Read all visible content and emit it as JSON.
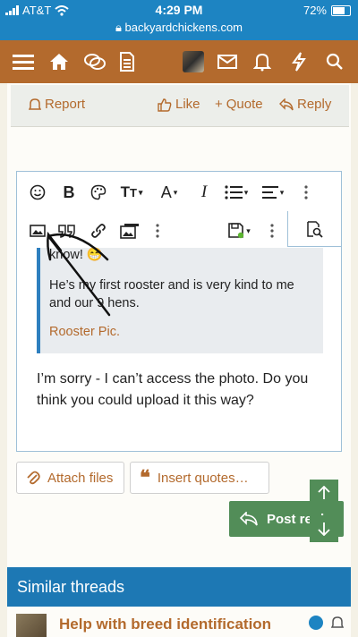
{
  "status_bar": {
    "carrier": "AT&T",
    "time": "4:29 PM",
    "url": "backyardchickens.com",
    "battery": "72%"
  },
  "nav": {
    "icons": [
      "menu-icon",
      "home-icon",
      "chat-icon",
      "document-icon",
      "avatar",
      "mail-icon",
      "bell-icon",
      "bolt-icon",
      "search-icon"
    ]
  },
  "post_actions": {
    "report": "Report",
    "like": "Like",
    "quote": "Quote",
    "reply": "Reply"
  },
  "editor": {
    "quote_line1": "know! 😁",
    "quote_line2": "He’s my first rooster and is very kind to me and our 9 hens.",
    "quote_link": "Rooster Pic.",
    "body": "I’m sorry - I can’t access the photo. Do you think you could upload it this way?"
  },
  "buttons": {
    "attach": "Attach files",
    "insert_quotes": "Insert quotes…",
    "post_reply": "Post reply"
  },
  "similar": {
    "title": "Similar threads",
    "first_item": "Help with breed identification"
  },
  "colors": {
    "status_blue": "#1d84c2",
    "nav_brown": "#b36a2d",
    "accent_green": "#528d58",
    "quote_border": "#2e7fbf"
  }
}
